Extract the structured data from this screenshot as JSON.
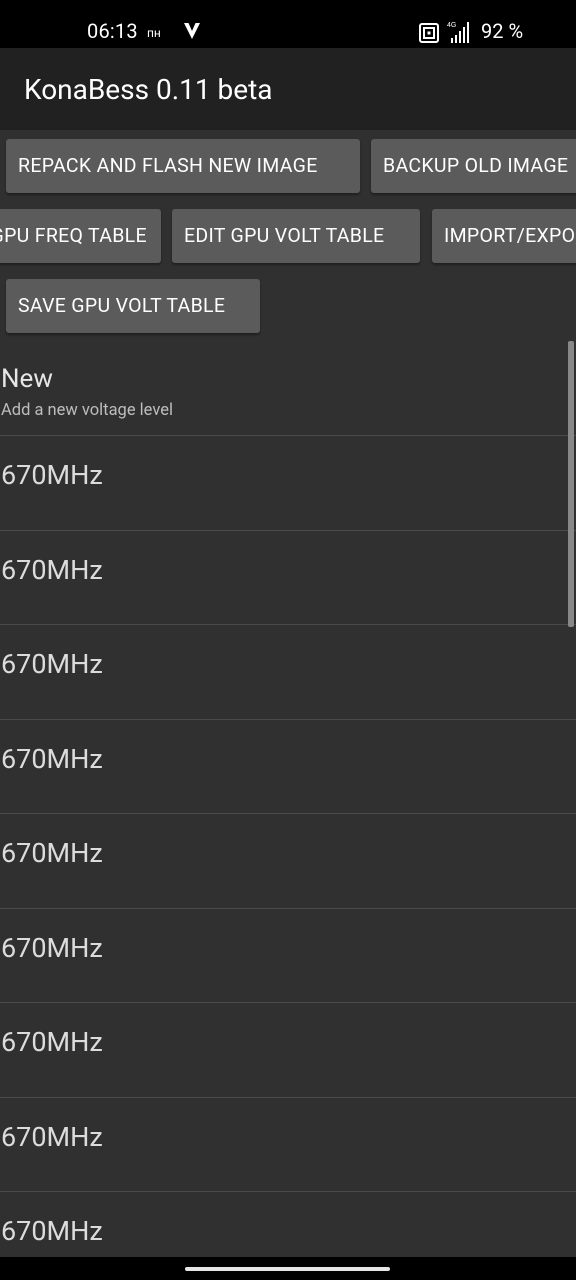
{
  "status_bar": {
    "time": "06:13",
    "day": "пн",
    "network_type": "4G",
    "battery": "92 %",
    "icons": [
      "v-icon",
      "nfc-icon",
      "signal-icon"
    ]
  },
  "app_bar": {
    "title": "KonaBess 0.11 beta"
  },
  "toolbar": {
    "repack_label": "REPACK AND FLASH NEW IMAGE",
    "backup_label": "BACKUP OLD IMAGE",
    "edit_freq_label": "EDIT GPU FREQ TABLE",
    "edit_volt_label": "EDIT GPU VOLT TABLE",
    "import_export_label": "IMPORT/EXPORT",
    "save_volt_label": "SAVE GPU VOLT TABLE"
  },
  "list": {
    "new_item": {
      "title": "New",
      "subtitle": "Add a new voltage level"
    },
    "levels": [
      {
        "label": "670MHz"
      },
      {
        "label": "670MHz"
      },
      {
        "label": "670MHz"
      },
      {
        "label": "670MHz"
      },
      {
        "label": "670MHz"
      },
      {
        "label": "670MHz"
      },
      {
        "label": "670MHz"
      },
      {
        "label": "670MHz"
      },
      {
        "label": "670MHz"
      }
    ]
  },
  "colors": {
    "background": "#303030",
    "app_bar": "#212121",
    "button": "#5b5b5b",
    "text_primary": "#ffffff",
    "text_secondary": "#bdbdbd"
  }
}
